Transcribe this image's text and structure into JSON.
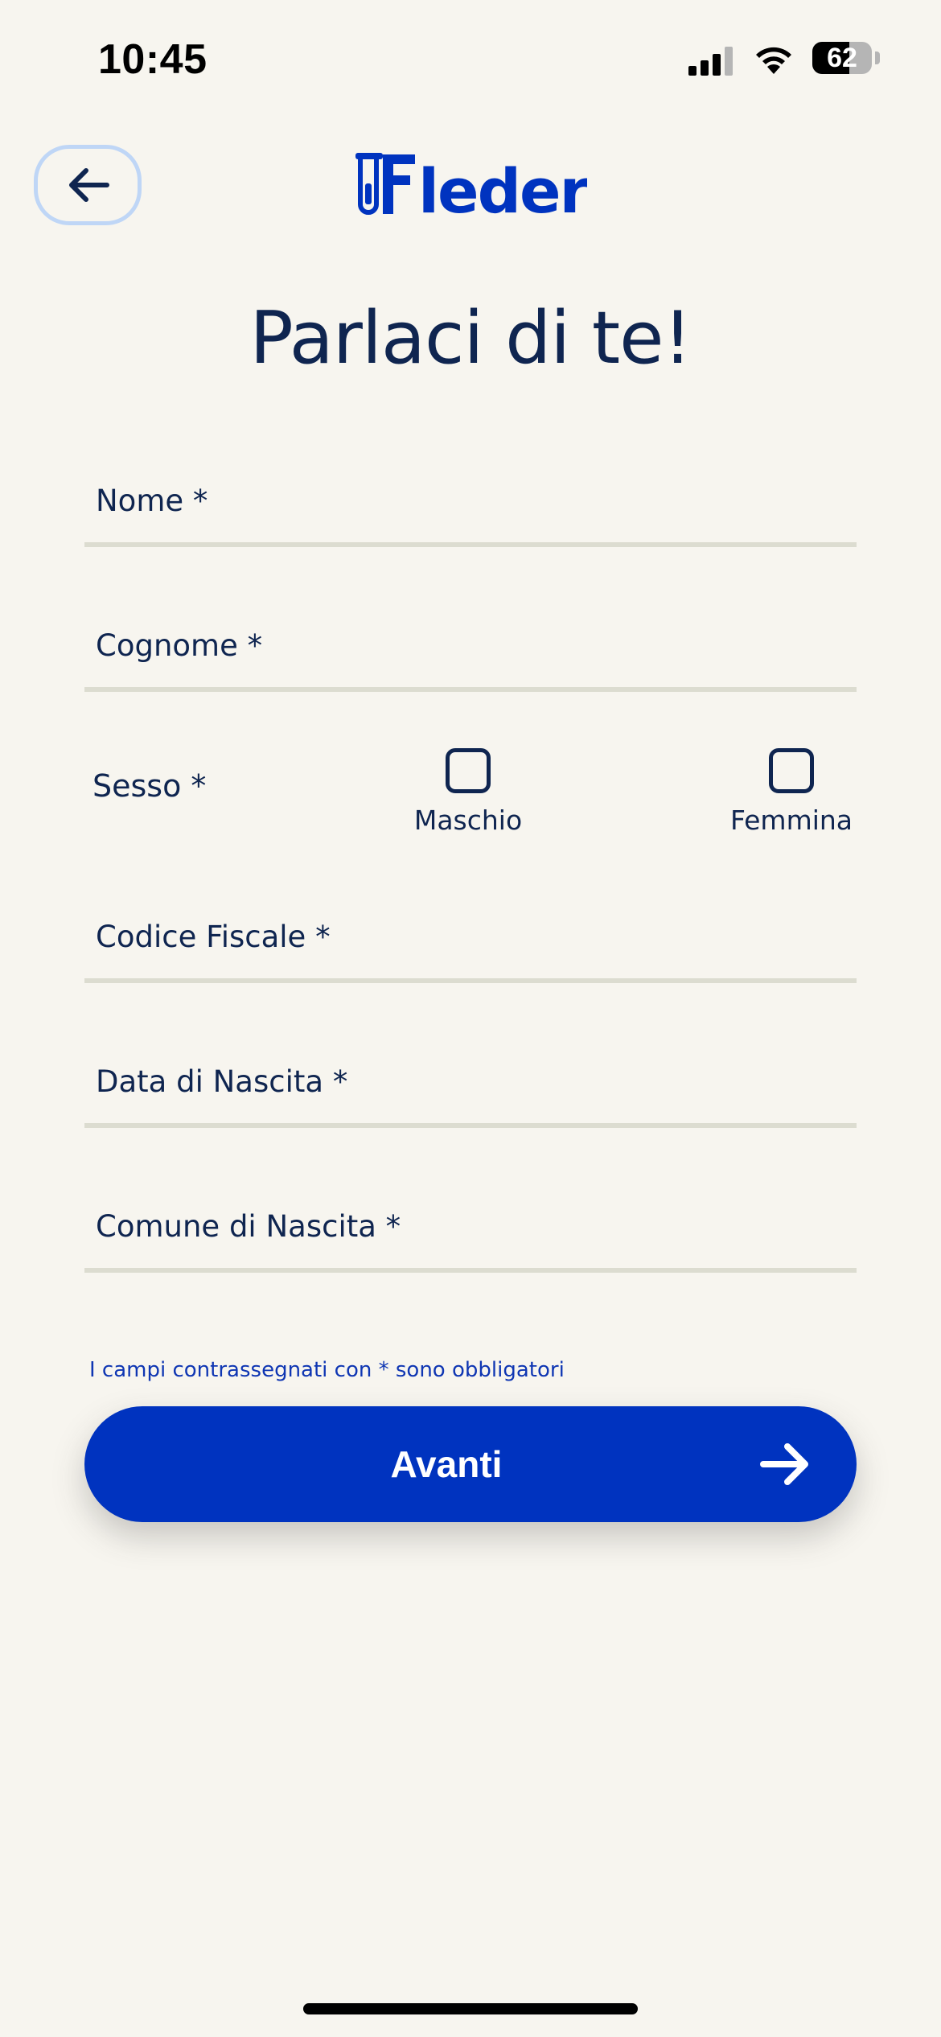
{
  "status_bar": {
    "time": "10:45",
    "battery_level": "62",
    "battery_fraction": 0.62,
    "icons": [
      "cellular-signal-icon",
      "wifi-icon",
      "battery-icon"
    ]
  },
  "header": {
    "back_icon": "arrow-left-icon",
    "logo_text": "Fleder"
  },
  "page": {
    "title": "Parlaci di te!"
  },
  "form": {
    "nome_placeholder": "Nome *",
    "cognome_placeholder": "Cognome *",
    "sesso_label": "Sesso *",
    "maschio_label": "Maschio",
    "femmina_label": "Femmina",
    "codice_fiscale_placeholder": "Codice Fiscale *",
    "data_nascita_placeholder": "Data di Nascita *",
    "comune_nascita_placeholder": "Comune di Nascita *",
    "required_note": "I campi contrassegnati con * sono obbligatori"
  },
  "actions": {
    "next_label": "Avanti",
    "next_icon": "arrow-right-icon"
  },
  "colors": {
    "background": "#f7f5ef",
    "primary": "#0033bf",
    "text": "#0f2550",
    "divider": "#dcdcd0",
    "back_border": "#bfd6f6"
  }
}
